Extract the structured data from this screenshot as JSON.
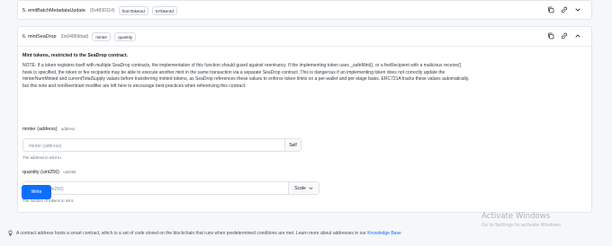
{
  "functions": [
    {
      "name": "5. emitBatchMetadataUpdate",
      "selector": "(0x4830114)",
      "params": [
        "fromTokenId",
        "toTokenId"
      ]
    },
    {
      "name": "6. mintSeaDrop",
      "selector": "(0x64869dad)",
      "params": [
        "minter",
        "quantity"
      ],
      "notice": "Mint tokens, restricted to the SeaDrop contract.",
      "description_lines": [
        "NOTE: If a token registers itself with multiple SeaDrop contracts, the implementation of this function should guard against reentrancy. If the implementing token uses _safeMint(), or a feeRecipient with a malicious receive()",
        "hook is specified, the token or fee recipients may be able to execute another mint in the same transaction via a separate SeaDrop contract. This is dangerous if an implementing token does not correctly update the",
        "minterNumMinted and currentTotalSupply values before transferring minted tokens, as SeaDrop references these values to enforce token limits on a per-wallet and per-stage basis. ERC721A tracks these values automatically,",
        "but this note and nonReentrant modifier are left here to encourage best-practices when referencing this contract."
      ],
      "inputs": [
        {
          "label": "minter (address)",
          "type": "address",
          "placeholder": "minter (address)",
          "button": "Self",
          "help": "The address to mint to."
        },
        {
          "label": "quantity (uint256)",
          "type": "uint256",
          "placeholder": "quantity (uint256)",
          "button": "Scale",
          "help": "The number of tokens to mint."
        }
      ],
      "write_label": "Write"
    }
  ],
  "footer": {
    "text": "A contract address hosts a smart contract, which is a set of code stored on the blockchain that runs when predetermined conditions are met. Learn more about addresses in our",
    "link": "Knowledge Base"
  },
  "watermark": {
    "line1": "Activate Windows",
    "line2": "Go to Settings to activate Windows."
  },
  "icons": {
    "copy": "copy-icon",
    "link": "link-icon",
    "expand": "chevron-down-icon",
    "collapse": "chevron-up-icon",
    "info": "lightbulb-icon"
  },
  "colors": {
    "accent": "#0d6efd",
    "border": "#dee2e6",
    "background": "#f6f7f9"
  }
}
